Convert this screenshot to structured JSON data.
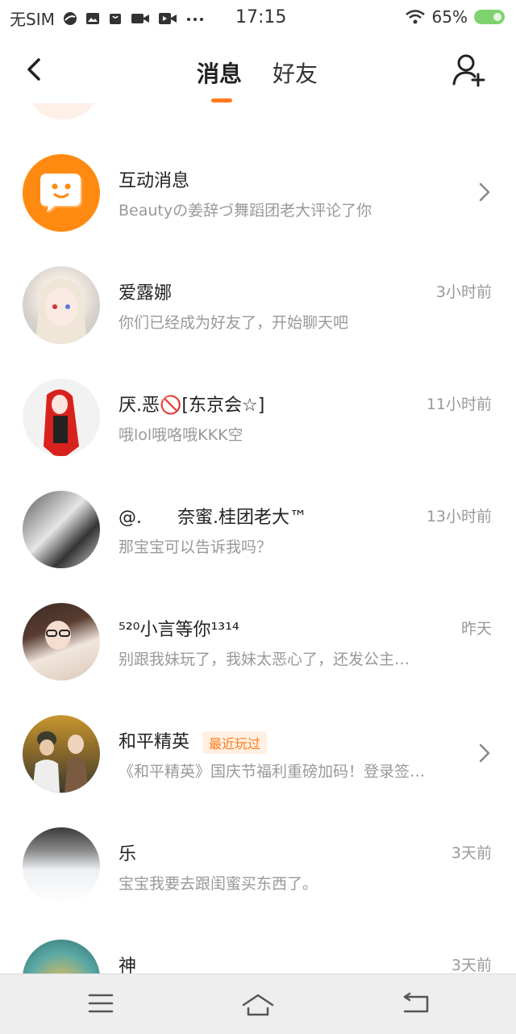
{
  "status_bar": {
    "carrier": "无SIM",
    "time": "17:15",
    "battery": "65%"
  },
  "header": {
    "tabs": [
      {
        "label": "消息",
        "active": true
      },
      {
        "label": "好友",
        "active": false
      }
    ]
  },
  "conversations": [
    {
      "name": "互动消息",
      "preview": "Beautyの姜辞づ舞蹈团老大评论了你",
      "time": "",
      "badge": "",
      "chevron": true
    },
    {
      "name": "爱露娜",
      "preview": "你们已经成为好友了，开始聊天吧",
      "time": "3小时前",
      "badge": "",
      "chevron": false
    },
    {
      "name": "厌.恶🚫[东京会☆]",
      "preview": "哦lol哦咯哦KKK空",
      "time": "11小时前",
      "badge": "",
      "chevron": false
    },
    {
      "name": "@.　　奈蜜.桂团老大™",
      "preview": "那宝宝可以告诉我吗？",
      "time": "13小时前",
      "badge": "",
      "chevron": false
    },
    {
      "name": "⁵²⁰小言等你¹³¹⁴",
      "preview": "别跟我妹玩了，我妹太恶心了，还发公主…",
      "time": "昨天",
      "badge": "",
      "chevron": false
    },
    {
      "name": "和平精英",
      "preview": "《和平精英》国庆节福利重磅加码！登录签…",
      "time": "",
      "badge": "最近玩过",
      "chevron": true
    },
    {
      "name": "乐",
      "preview": "宝宝我要去跟闺蜜买东西了。",
      "time": "3天前",
      "badge": "",
      "chevron": false
    },
    {
      "name": "神",
      "preview": "",
      "time": "3天前",
      "badge": "",
      "chevron": false
    }
  ],
  "colors": {
    "accent": "#ff7a1a",
    "secondary_text": "#999999",
    "primary_text": "#222222"
  },
  "icons": [
    "back-arrow-icon",
    "add-friend-icon",
    "chevron-right-icon",
    "menu-icon",
    "home-icon",
    "return-icon"
  ]
}
